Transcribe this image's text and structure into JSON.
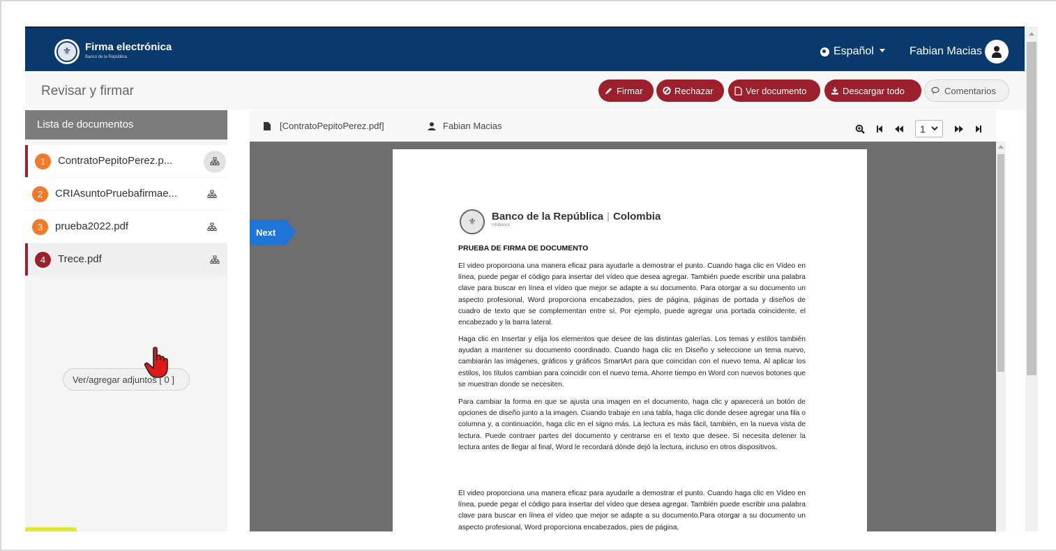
{
  "header": {
    "brand_title": "Firma electrónica",
    "brand_subtitle": "Banco de la República",
    "language": "Español",
    "user_name": "Fabian Macias"
  },
  "titlebar": {
    "page_title": "Revisar y firmar",
    "actions": {
      "sign": "Firmar",
      "reject": "Rechazar",
      "view": "Ver documento",
      "download": "Descargar todo",
      "comments": "Comentarios"
    }
  },
  "sidebar": {
    "heading": "Lista de documentos",
    "documents": [
      {
        "number": "1",
        "name": "ContratoPepitoPerez.p..."
      },
      {
        "number": "2",
        "name": "CRIAsuntoPruebafirmae..."
      },
      {
        "number": "3",
        "name": "prueba2022.pdf"
      },
      {
        "number": "4",
        "name": "Trece.pdf"
      }
    ],
    "attachments_button": "Ver/agregar adjuntos [ 0 ]"
  },
  "viewer": {
    "file_name": "[ContratoPepitoPerez.pdf]",
    "signer": "Fabian Macias",
    "page_value": "1",
    "next_label": "Next"
  },
  "document": {
    "brand_left": "Banco de la República",
    "brand_sep": "|",
    "brand_right": "Colombia",
    "brand_sub": "Infobanco",
    "heading": "PRUEBA DE FIRMA DE DOCUMENTO",
    "paragraphs": [
      "El video proporciona una manera eficaz para ayudarle a demostrar el punto. Cuando haga clic en Vídeo en línea, puede pegar el código para insertar del vídeo que desea agregar. También puede escribir una palabra clave para buscar en línea el vídeo que mejor se adapte a su documento. Para otorgar a su documento un aspecto profesional, Word proporciona encabezados, pies de página, páginas de portada y diseños de cuadro de texto que se complementan entre sí. Por ejemplo, puede agregar una portada coincidente, el encabezado y la barra lateral.",
      "Haga clic en Insertar y elija los elementos que desee de las distintas galerías. Los temas y estilos también ayudan a mantener su documento coordinado. Cuando haga clic en Diseño y seleccione un tema nuevo, cambiarán las imágenes, gráficos y gráficos SmartArt para que coincidan con el nuevo tema. Al aplicar los estilos, los títulos cambian para coincidir con el nuevo tema. Ahorre tiempo en Word con nuevos botones que se muestran donde se necesiten.",
      "Para cambiar la forma en que se ajusta una imagen en el documento, haga clic y aparecerá un botón de opciones de diseño junto a la imagen. Cuando trabaje en una tabla, haga clic donde desee agregar una fila o columna y, a continuación, haga clic en el signo más. La lectura es más fácil, también, en la nueva vista de lectura. Puede contraer partes del documento y centrarse en el texto que desee. Si necesita detener la lectura antes de llegar al final, Word le recordará dónde dejó la lectura, incluso en otros dispositivos.",
      "El video proporciona una manera eficaz para ayudarle a demostrar el punto. Cuando haga clic en Vídeo en línea, puede pegar el código para insertar del vídeo que desea agregar. También puede escribir una palabra clave para buscar en línea el vídeo que mejor se adapte a su documento.Para otorgar a su documento un aspecto profesional, Word proporciona encabezados, pies de página,"
    ]
  },
  "colors": {
    "navy": "#0a3a6b",
    "accent_red": "#9c1f2c",
    "badge_orange": "#f07a2a",
    "next_blue": "#1f74d8"
  },
  "icons": [
    "globe-icon",
    "user-icon",
    "pencil-icon",
    "ban-icon",
    "file-icon",
    "download-icon",
    "comments-icon",
    "sitemap-icon",
    "zoom-icon",
    "first-page-icon",
    "prev-page-icon",
    "next-page-icon",
    "last-page-icon",
    "hand-pointer-icon"
  ]
}
